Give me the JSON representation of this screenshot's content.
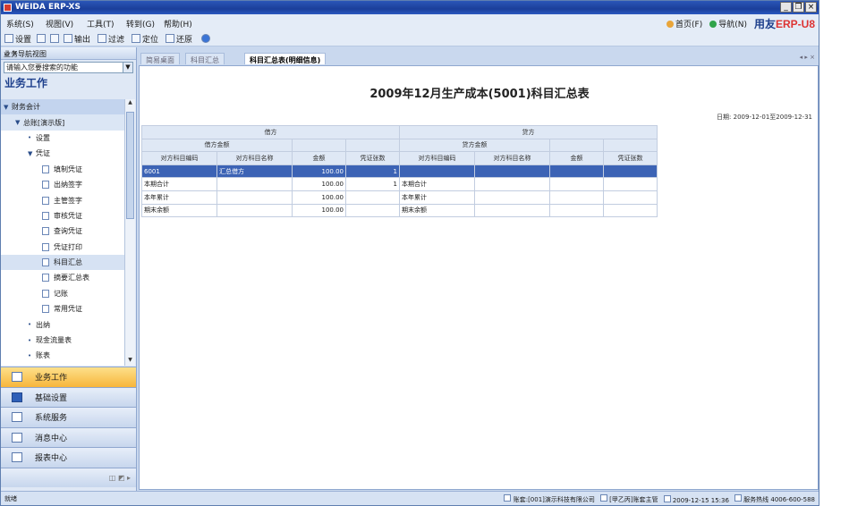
{
  "window": {
    "title": "WEIDA ERP-XS"
  },
  "menubar": {
    "items": [
      "系统(S)",
      "视图(V)",
      "工具(T)",
      "转到(G)",
      "帮助(H)"
    ],
    "links": [
      "首页(F)",
      "导航(N)"
    ],
    "brand": "用友",
    "brand_product": "ERP-",
    "brand_suffix": "U8"
  },
  "toolbar": {
    "items": [
      "设置",
      "",
      "",
      "输出",
      "过滤",
      "定位",
      "还原"
    ]
  },
  "sidebar": {
    "header": "业务导航视图",
    "search_placeholder": "请输入您要搜索的功能",
    "section_title": "业务工作",
    "tree": [
      {
        "label": "财务会计",
        "level": 0,
        "exp": "▼"
      },
      {
        "label": "总账[演示版]",
        "level": 1,
        "exp": "▼"
      },
      {
        "label": "设置",
        "level": 2,
        "exp": "•"
      },
      {
        "label": "凭证",
        "level": 2,
        "exp": "▼"
      },
      {
        "label": "填制凭证",
        "level": 3
      },
      {
        "label": "出纳签字",
        "level": 3
      },
      {
        "label": "主管签字",
        "level": 3
      },
      {
        "label": "审核凭证",
        "level": 3
      },
      {
        "label": "查询凭证",
        "level": 3
      },
      {
        "label": "凭证打印",
        "level": 3
      },
      {
        "label": "科目汇总",
        "level": 3,
        "selected": true
      },
      {
        "label": "摘要汇总表",
        "level": 3
      },
      {
        "label": "记账",
        "level": 3
      },
      {
        "label": "常用凭证",
        "level": 3
      },
      {
        "label": "出纳",
        "level": 2,
        "exp": "•"
      },
      {
        "label": "现金流量表",
        "level": 2,
        "exp": "•"
      },
      {
        "label": "账表",
        "level": 2,
        "exp": "•"
      }
    ],
    "nav_buttons": [
      "业务工作",
      "基础设置",
      "系统服务",
      "消息中心",
      "报表中心"
    ]
  },
  "tabs": [
    "简易桌面",
    "科目汇总",
    "科目汇总表(明细信息)"
  ],
  "report": {
    "title": "2009年12月生产成本(5001)科目汇总表",
    "date_range": "日期: 2009-12-01至2009-12-31",
    "group_headers": [
      "借方",
      "贷方"
    ],
    "sub_headers": [
      "借方金额",
      "贷方金额"
    ],
    "columns": [
      "对方科目编码",
      "对方科目名称",
      "金额",
      "凭证张数",
      "对方科目编码",
      "对方科目名称",
      "金额",
      "凭证张数"
    ],
    "rows": [
      [
        "6001",
        "汇总借方",
        "100.00",
        "1",
        "",
        "",
        "",
        ""
      ],
      [
        "本期合计",
        "",
        "100.00",
        "1",
        "本期合计",
        "",
        "",
        ""
      ],
      [
        "本年累计",
        "",
        "100.00",
        "",
        "本年累计",
        "",
        "",
        ""
      ],
      [
        "期末余额",
        "",
        "100.00",
        "",
        "期末余额",
        "",
        "",
        ""
      ]
    ]
  },
  "status": {
    "ready": "就绪",
    "account": "账套:[001]演示科技有限公司",
    "user": "[甲乙丙]账套主管",
    "datetime": "2009-12-15 15:36",
    "hotline": "服务热线 4006-600-588"
  },
  "colors": {
    "accent": "#1d3f8c",
    "selection": "#3c63b5",
    "active_nav": "#f7b53b"
  }
}
